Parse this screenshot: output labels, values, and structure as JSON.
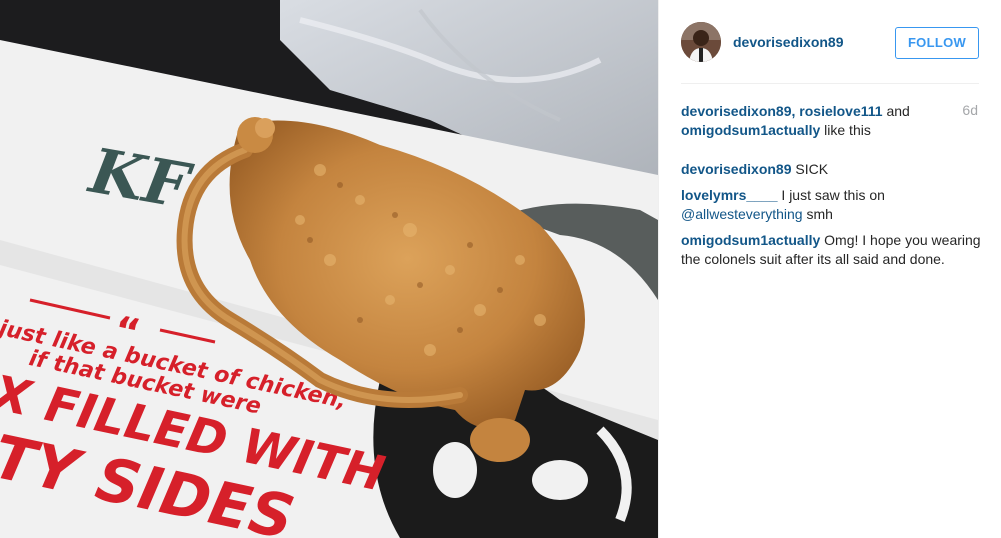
{
  "post": {
    "username": "devorisedixon89",
    "follow_label": "FOLLOW",
    "age": "6d"
  },
  "likes": {
    "user1": "devorisedixon89,",
    "user2": "rosielove111",
    "and": "and",
    "user3": "omigodsum1actually",
    "suffix": "like this"
  },
  "comments": [
    {
      "user": "devorisedixon89",
      "text": "SICK"
    },
    {
      "user": "lovelymrs____",
      "text_before": "I just saw this on",
      "mention": "@allwesteverything",
      "text_after": "smh"
    },
    {
      "user": "omigodsum1actually",
      "text": "Omg! I hope you wearing the colonels suit after its all said and done."
    }
  ],
  "photo": {
    "box_text_partial": "KF",
    "quote_line1": "just like a bucket of chicken,",
    "quote_line2": "if that bucket were",
    "big_line1": "X FILLED WITH",
    "big_line2": "TY SIDES",
    "quote_mark": "“",
    "colors": {
      "box_red": "#d6202a",
      "box_white": "#f1f1f1",
      "chicken": "#c9873e"
    }
  }
}
